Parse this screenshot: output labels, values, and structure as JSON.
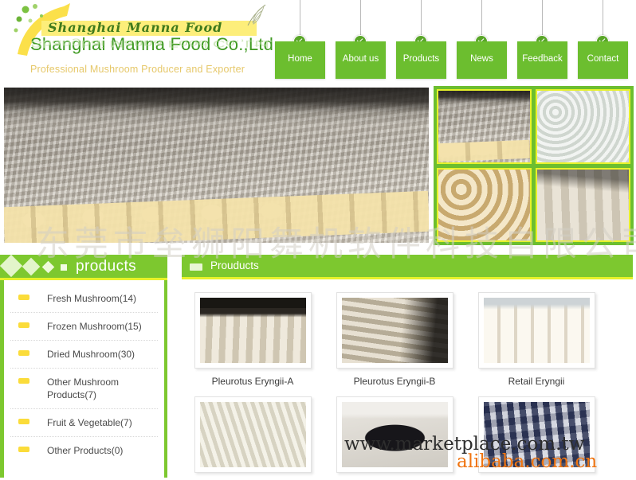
{
  "header": {
    "logo_script": "Shanghai Manna Food",
    "logo_title": "Shanghai Manna Food Co.,Ltd.",
    "logo_tagline": "Professional Mushroom Producer and Exporter",
    "nav": [
      {
        "label": "Home",
        "icon": "check-circle-icon"
      },
      {
        "label": "About  us",
        "icon": "check-circle-icon"
      },
      {
        "label": "Products",
        "icon": "check-circle-icon"
      },
      {
        "label": "News",
        "icon": "check-circle-icon"
      },
      {
        "label": "Feedback",
        "icon": "check-circle-icon"
      },
      {
        "label": "Contact",
        "icon": "check-circle-icon"
      }
    ]
  },
  "banner": {
    "main_image_alt": "mushroom-growing-house",
    "thumbnails": [
      {
        "alt": "mushroom-growing-beds"
      },
      {
        "alt": "white-mushroom-cluster"
      },
      {
        "alt": "dried-shiitake-mushrooms"
      },
      {
        "alt": "king-oyster-mushrooms"
      }
    ]
  },
  "sidebar": {
    "title": "products",
    "categories": [
      {
        "label": "Fresh Mushroom(14)"
      },
      {
        "label": "Frozen Mushroom(15)"
      },
      {
        "label": "Dried Mushroom(30)"
      },
      {
        "label": "Other Mushroom Products(7)"
      },
      {
        "label": "Fruit & Vegetable(7)"
      },
      {
        "label": "Other Products(0)"
      }
    ]
  },
  "main": {
    "title": "Prouducts",
    "products": [
      {
        "caption": "Pleurotus Eryngii-A",
        "image": "eryngii-farm"
      },
      {
        "caption": "Pleurotus Eryngii-B",
        "image": "eryngii-wall"
      },
      {
        "caption": "Retail Eryngii",
        "image": "retail-tray"
      },
      {
        "caption": "",
        "image": "enoki-mushroom"
      },
      {
        "caption": "",
        "image": "packed-tray"
      },
      {
        "caption": "",
        "image": "packed-bags"
      }
    ]
  },
  "watermarks": {
    "chinese": "东莞市垒狮阳舞机软件科技自限公司",
    "marketplace": "www.marketplace.com.tw",
    "alibaba": "alibaba.com.cn"
  },
  "colors": {
    "brand_green": "#6cbe2f",
    "panel_green": "#7dc82f",
    "accent_yellow": "#e8f22a",
    "bullet_yellow": "#fbdc3a",
    "logo_green": "#3f9a22",
    "alibaba_orange": "#f07410"
  }
}
